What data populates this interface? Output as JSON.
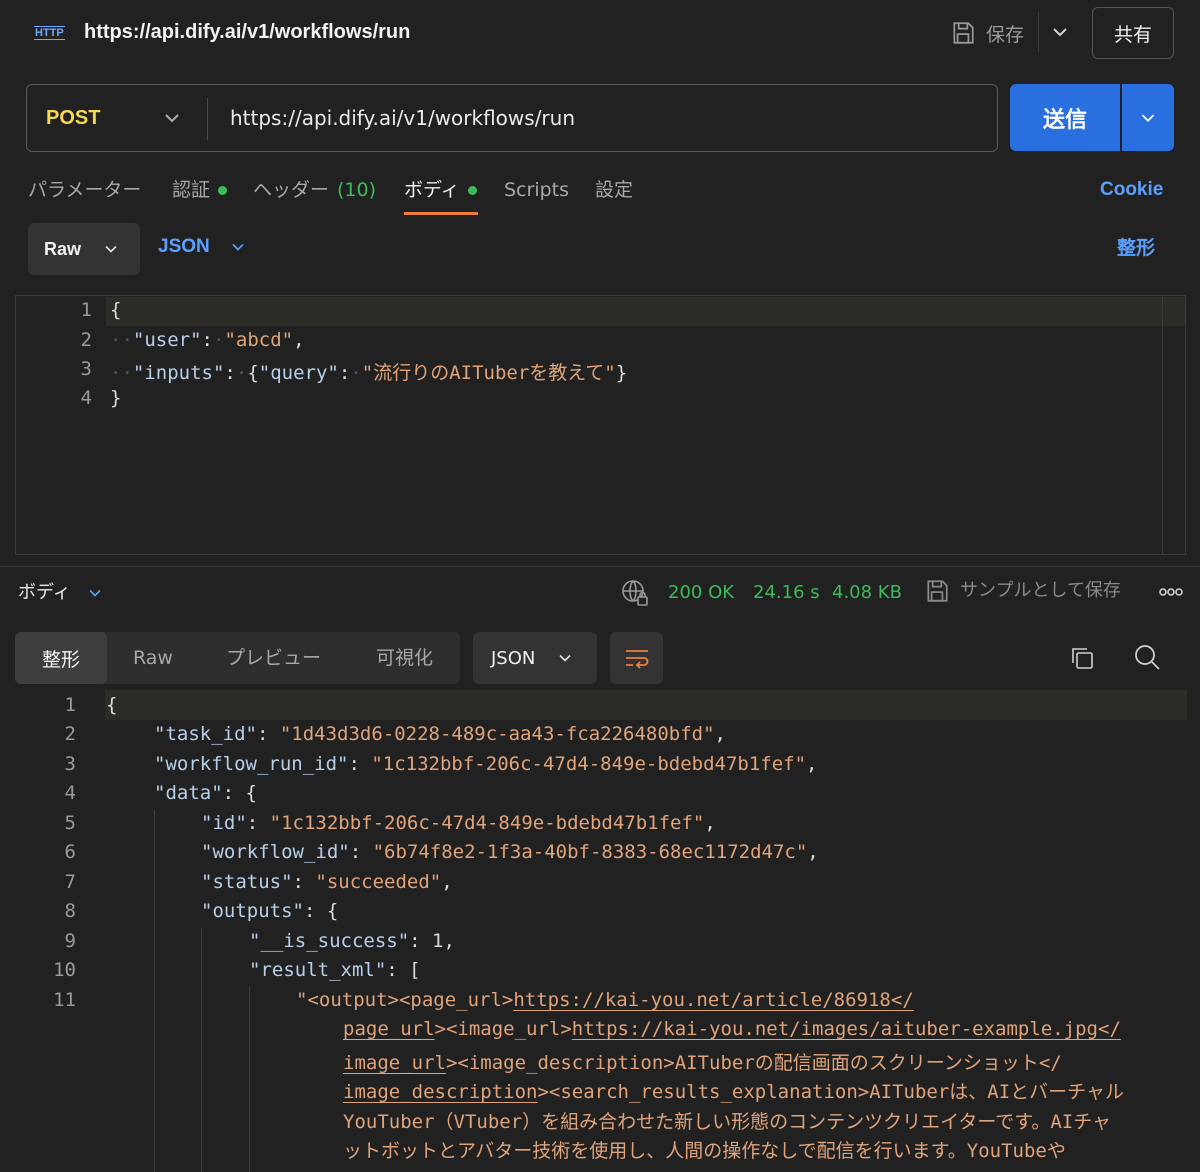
{
  "header": {
    "title": "https://api.dify.ai/v1/workflows/run",
    "save_label": "保存",
    "share_label": "共有"
  },
  "request": {
    "method": "POST",
    "url": "https://api.dify.ai/v1/workflows/run",
    "send_label": "送信"
  },
  "tabs": {
    "params": "パラメーター",
    "auth": "認証",
    "headers": "ヘッダー",
    "headers_count": "(10)",
    "body": "ボディ",
    "scripts": "Scripts",
    "settings": "設定",
    "cookie": "Cookie"
  },
  "body_format": {
    "mode": "Raw",
    "language": "JSON",
    "beautify": "整形"
  },
  "request_body": {
    "line_numbers": [
      "1",
      "2",
      "3",
      "4"
    ],
    "open_brace": "{",
    "close_brace": "}",
    "user_key": "\"user\"",
    "user_value": "\"abcd\"",
    "inputs_key": "\"inputs\"",
    "query_key": "\"query\"",
    "query_value": "\"流行りのAITuberを教えて\""
  },
  "response": {
    "title": "ボディ",
    "status": "200 OK",
    "time": "24.16 s",
    "size": "4.08 KB",
    "save_sample": "サンプルとして保存",
    "tabs": {
      "pretty": "整形",
      "raw": "Raw",
      "preview": "プレビュー",
      "visualize": "可視化"
    },
    "format": "JSON",
    "line_numbers": [
      "1",
      "2",
      "3",
      "4",
      "5",
      "6",
      "7",
      "8",
      "9",
      "10",
      "11"
    ],
    "body": {
      "task_id_key": "\"task_id\"",
      "task_id_value": "\"1d43d3d6-0228-489c-aa43-fca226480bfd\"",
      "workflow_run_id_key": "\"workflow_run_id\"",
      "workflow_run_id_value": "\"1c132bbf-206c-47d4-849e-bdebd47b1fef\"",
      "data_key": "\"data\"",
      "id_key": "\"id\"",
      "id_value": "\"1c132bbf-206c-47d4-849e-bdebd47b1fef\"",
      "workflow_id_key": "\"workflow_id\"",
      "workflow_id_value": "\"6b74f8e2-1f3a-40bf-8383-68ec1172d47c\"",
      "status_key": "\"status\"",
      "status_value": "\"succeeded\"",
      "outputs_key": "\"outputs\"",
      "is_success_key": "\"__is_success\"",
      "is_success_value": "1",
      "result_xml_key": "\"result_xml\"",
      "xml_l1_pre": "\"<output><page_url>",
      "xml_l1_link": "https://kai-you.net/article/86918",
      "xml_l1_post": "</",
      "xml_l2_a": "page_url",
      "xml_l2_b": "><image_url>",
      "xml_l2_link": "https://kai-you.net/images/aituber-example.jpg",
      "xml_l2_c": "</",
      "xml_l3_a": "image_url",
      "xml_l3_b": "><image_description>AITuberの配信画面のスクリーンショット</",
      "xml_l4_a": "image_description",
      "xml_l4_b": "><search_results_explanation>AITuberは、AIとバーチャル",
      "xml_l5": "YouTuber（VTuber）を組み合わせた新しい形態のコンテンツクリエイターです。AIチャ",
      "xml_l6": "ットボットとアバター技術を使用し、人間の操作なしで配信を行います。YouTubeや"
    }
  },
  "colors": {
    "accent": "#2a6fe0",
    "method": "#f5d94f",
    "success": "#3dbb5a",
    "tab_active": "#f07b3f",
    "link": "#5aa0ff"
  }
}
